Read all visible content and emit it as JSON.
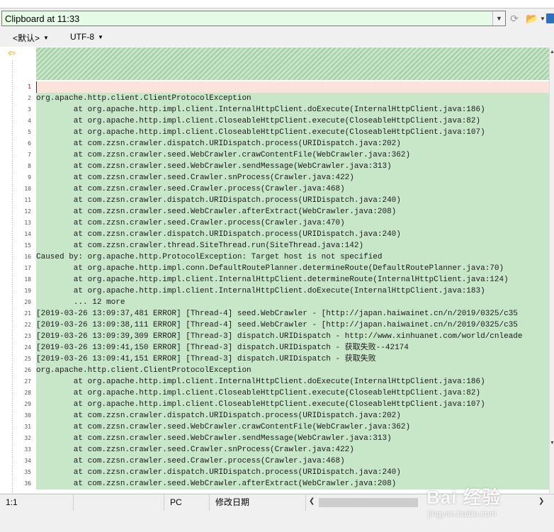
{
  "window": {
    "title": "Clipboard at 11:33"
  },
  "toolbar": {
    "combo_arrow_icon": "chevron-down-icon",
    "refresh_icon": "refresh-icon",
    "open_icon": "folder-open-icon",
    "save_icon": "save-icon"
  },
  "encoding": {
    "language": "<默认>",
    "charset": "UTF-8"
  },
  "editor": {
    "marker_icon": "arrow-left-icon",
    "lines": [
      {
        "num": "1",
        "text": ""
      },
      {
        "num": "2",
        "text": "org.apache.http.client.ClientProtocolException"
      },
      {
        "num": "3",
        "text": "        at org.apache.http.impl.client.InternalHttpClient.doExecute(InternalHttpClient.java:186)"
      },
      {
        "num": "4",
        "text": "        at org.apache.http.impl.client.CloseableHttpClient.execute(CloseableHttpClient.java:82)"
      },
      {
        "num": "5",
        "text": "        at org.apache.http.impl.client.CloseableHttpClient.execute(CloseableHttpClient.java:107)"
      },
      {
        "num": "6",
        "text": "        at com.zzsn.crawler.dispatch.URIDispatch.process(URIDispatch.java:202)"
      },
      {
        "num": "7",
        "text": "        at com.zzsn.crawler.seed.WebCrawler.crawContentFile(WebCrawler.java:362)"
      },
      {
        "num": "8",
        "text": "        at com.zzsn.crawler.seed.WebCrawler.sendMessage(WebCrawler.java:313)"
      },
      {
        "num": "9",
        "text": "        at com.zzsn.crawler.seed.Crawler.snProcess(Crawler.java:422)"
      },
      {
        "num": "10",
        "text": "        at com.zzsn.crawler.seed.Crawler.process(Crawler.java:468)"
      },
      {
        "num": "11",
        "text": "        at com.zzsn.crawler.dispatch.URIDispatch.process(URIDispatch.java:240)"
      },
      {
        "num": "12",
        "text": "        at com.zzsn.crawler.seed.WebCrawler.afterExtract(WebCrawler.java:208)"
      },
      {
        "num": "13",
        "text": "        at com.zzsn.crawler.seed.Crawler.process(Crawler.java:470)"
      },
      {
        "num": "14",
        "text": "        at com.zzsn.crawler.dispatch.URIDispatch.process(URIDispatch.java:240)"
      },
      {
        "num": "15",
        "text": "        at com.zzsn.crawler.thread.SiteThread.run(SiteThread.java:142)"
      },
      {
        "num": "16",
        "text": "Caused by: org.apache.http.ProtocolException: Target host is not specified"
      },
      {
        "num": "17",
        "text": "        at org.apache.http.impl.conn.DefaultRoutePlanner.determineRoute(DefaultRoutePlanner.java:70)"
      },
      {
        "num": "18",
        "text": "        at org.apache.http.impl.client.InternalHttpClient.determineRoute(InternalHttpClient.java:124)"
      },
      {
        "num": "19",
        "text": "        at org.apache.http.impl.client.InternalHttpClient.doExecute(InternalHttpClient.java:183)"
      },
      {
        "num": "20",
        "text": "        ... 12 more"
      },
      {
        "num": "21",
        "text": "[2019-03-26 13:09:37,481 ERROR] [Thread-4] seed.WebCrawler - [http://japan.haiwainet.cn/n/2019/0325/c35"
      },
      {
        "num": "22",
        "text": "[2019-03-26 13:09:38,111 ERROR] [Thread-4] seed.WebCrawler - [http://japan.haiwainet.cn/n/2019/0325/c35"
      },
      {
        "num": "23",
        "text": "[2019-03-26 13:09:39,309 ERROR] [Thread-3] dispatch.URIDispatch - http://www.xinhuanet.com/world/cnleade"
      },
      {
        "num": "24",
        "text": "[2019-03-26 13:09:41,150 ERROR] [Thread-3] dispatch.URIDispatch - 获取失败--42174"
      },
      {
        "num": "25",
        "text": "[2019-03-26 13:09:41,151 ERROR] [Thread-3] dispatch.URIDispatch - 获取失败"
      },
      {
        "num": "26",
        "text": "org.apache.http.client.ClientProtocolException"
      },
      {
        "num": "27",
        "text": "        at org.apache.http.impl.client.InternalHttpClient.doExecute(InternalHttpClient.java:186)"
      },
      {
        "num": "28",
        "text": "        at org.apache.http.impl.client.CloseableHttpClient.execute(CloseableHttpClient.java:82)"
      },
      {
        "num": "29",
        "text": "        at org.apache.http.impl.client.CloseableHttpClient.execute(CloseableHttpClient.java:107)"
      },
      {
        "num": "30",
        "text": "        at com.zzsn.crawler.dispatch.URIDispatch.process(URIDispatch.java:202)"
      },
      {
        "num": "31",
        "text": "        at com.zzsn.crawler.seed.WebCrawler.crawContentFile(WebCrawler.java:362)"
      },
      {
        "num": "32",
        "text": "        at com.zzsn.crawler.seed.WebCrawler.sendMessage(WebCrawler.java:313)"
      },
      {
        "num": "33",
        "text": "        at com.zzsn.crawler.seed.Crawler.snProcess(Crawler.java:422)"
      },
      {
        "num": "34",
        "text": "        at com.zzsn.crawler.seed.Crawler.process(Crawler.java:468)"
      },
      {
        "num": "35",
        "text": "        at com.zzsn.crawler.dispatch.URIDispatch.process(URIDispatch.java:240)"
      },
      {
        "num": "36",
        "text": "        at com.zzsn.crawler.seed.WebCrawler.afterExtract(WebCrawler.java:208)"
      }
    ]
  },
  "status": {
    "position": "1:1",
    "mode": "PC",
    "date_label": "修改日期"
  },
  "watermark": {
    "brand": "Bai  经验",
    "sub": "jingyan.baidu.com"
  },
  "colors": {
    "title_bg": "#e6fbe6",
    "line_bg": "#c8e6c8",
    "current_line": "#fbe2da",
    "marker": "#e2a400"
  }
}
